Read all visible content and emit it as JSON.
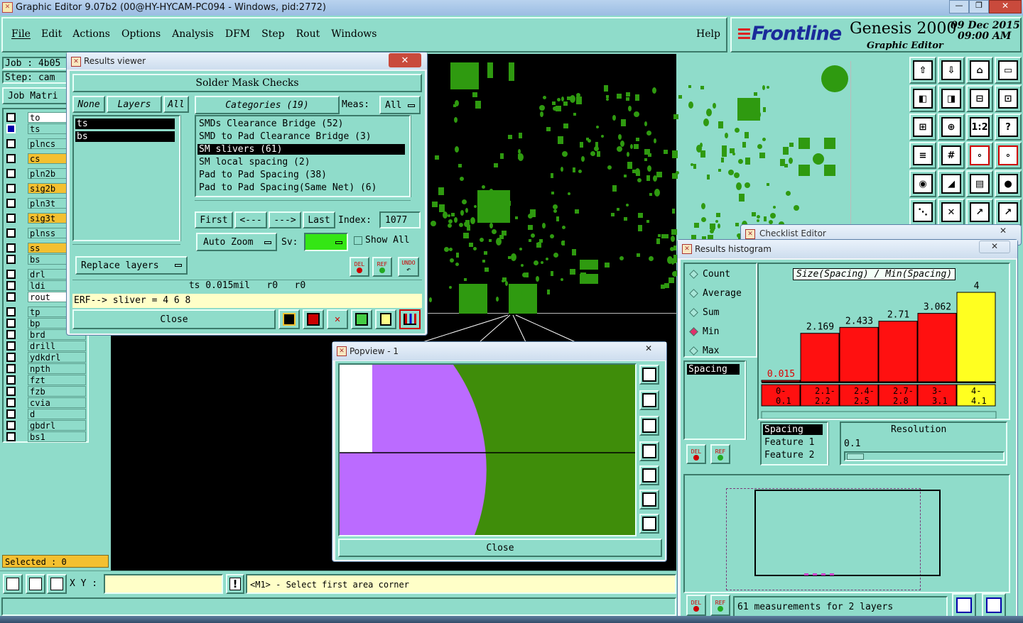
{
  "app": {
    "title": "Graphic Editor 9.07b2 (00@HY-HYCAM-PC094 - Windows, pid:2772)",
    "window_controls": [
      "—",
      "❐",
      "✕"
    ]
  },
  "menu": {
    "items": [
      "File",
      "Edit",
      "Actions",
      "Options",
      "Analysis",
      "DFM",
      "Step",
      "Rout",
      "Windows"
    ],
    "help": "Help"
  },
  "brand": {
    "logo": "Frontline",
    "product": "Genesis 2000",
    "subtitle": "Graphic Editor",
    "date": "09 Dec 2015",
    "time": "09:00 AM"
  },
  "job": {
    "job_label": "Job : 4b05",
    "step_label": "Step: cam",
    "matrix_button": "Job Matri"
  },
  "layers": [
    {
      "name": "to",
      "color": "#ffffff"
    },
    {
      "name": "ts",
      "color": "#8fdcca",
      "active": true
    },
    {
      "name": "plncs",
      "color": "#8fdcca"
    },
    {
      "name": "cs",
      "color": "#f4c030"
    },
    {
      "name": "pln2b",
      "color": "#8fdcca"
    },
    {
      "name": "sig2b",
      "color": "#f4c030"
    },
    {
      "name": "pln3t",
      "color": "#8fdcca"
    },
    {
      "name": "sig3t",
      "color": "#f4c030"
    },
    {
      "name": "plnss",
      "color": "#8fdcca"
    },
    {
      "name": "ss",
      "color": "#f4c030"
    },
    {
      "name": "bs",
      "color": "#8fdcca"
    },
    {
      "name": "drl",
      "color": "#8fdcca"
    },
    {
      "name": "ldi",
      "color": "#8fdcca"
    },
    {
      "name": "rout",
      "color": "#ffffff"
    },
    {
      "name": "tp",
      "color": "#8fdcca"
    },
    {
      "name": "bp",
      "color": "#8fdcca"
    },
    {
      "name": "brd",
      "color": "#8fdcca"
    },
    {
      "name": "drill",
      "color": "#8fdcca"
    },
    {
      "name": "ydkdrl",
      "color": "#8fdcca"
    },
    {
      "name": "npth",
      "color": "#8fdcca"
    },
    {
      "name": "fzt",
      "color": "#8fdcca"
    },
    {
      "name": "fzb",
      "color": "#8fdcca"
    },
    {
      "name": "cvia",
      "color": "#8fdcca"
    },
    {
      "name": "d",
      "color": "#8fdcca"
    },
    {
      "name": "gbdrl",
      "color": "#8fdcca"
    },
    {
      "name": "bs1",
      "color": "#8fdcca"
    }
  ],
  "selected": "Selected : 0",
  "statusbar": {
    "xy_label": "X Y :",
    "xy_value": "",
    "message": "<M1> - Select first area corner"
  },
  "results_viewer": {
    "title": "Results viewer",
    "header": "Solder Mask Checks",
    "none_btn": "None",
    "layers_btn": "Layers",
    "all_btn": "All",
    "layer_items": [
      "ts",
      "bs"
    ],
    "categories_btn": "Categories (19)",
    "meas_label": "Meas:",
    "meas_value": "All",
    "categories": [
      "SMDs Clearance Bridge (52)",
      "SMD to Pad Clearance Bridge (3)",
      "SM slivers (61)",
      "SM local spacing (2)",
      "Pad to Pad Spacing (38)",
      "Pad to Pad Spacing(Same Net) (6)"
    ],
    "selected_category": 2,
    "first": "First",
    "prev": "<---",
    "next": "--->",
    "last": "Last",
    "index_label": "Index:",
    "index_value": "1077",
    "auto_zoom": "Auto Zoom",
    "sv_label": "Sv:",
    "show_all": "Show All",
    "replace_layers": "Replace layers",
    "del": "DEL",
    "ref": "REF",
    "undo": "UNDO",
    "info_line": "ts 0.015mil   r0   r0",
    "erf_line": "ERF--> sliver = 4 6 8",
    "close": "Close"
  },
  "popview": {
    "title": "Popview - 1",
    "close": "Close"
  },
  "checklist": {
    "title": "Checklist Editor"
  },
  "histogram": {
    "title": "Results histogram",
    "radio_options": [
      "Count",
      "Average",
      "Sum",
      "Min",
      "Max"
    ],
    "selected_option": "Min",
    "list_items": [
      "Spacing"
    ],
    "chart_title": "Size(Spacing) / Min(Spacing)",
    "del": "DEL",
    "ref": "REF",
    "feature_list": [
      "Spacing",
      "Feature 1",
      "Feature 2"
    ],
    "resolution_label": "Resolution",
    "resolution_value": "0.1",
    "summary": "61 measurements for 2 layers"
  },
  "chart_data": {
    "type": "bar",
    "title": "Size(Spacing) / Min(Spacing)",
    "categories": [
      "0-0.1",
      "2.1-2.2",
      "2.4-2.5",
      "2.7-2.8",
      "3-3.1",
      "4-4.1"
    ],
    "values": [
      0.015,
      2.169,
      2.433,
      2.71,
      3.062,
      4
    ],
    "labels": [
      "0.015",
      "2.169",
      "2.433",
      "2.71",
      "3.062",
      "4"
    ],
    "bin_labels_line1": [
      "0-",
      "2.1-",
      "2.4-",
      "2.7-",
      "3-",
      "4-"
    ],
    "bin_labels_line2": [
      "0.1",
      "2.2",
      "2.5",
      "2.8",
      "3.1",
      "4.1"
    ],
    "colors": [
      "#ff1010",
      "#ff1010",
      "#ff1010",
      "#ff1010",
      "#ff1010",
      "#ffff20"
    ],
    "ylim": [
      0,
      4
    ]
  },
  "colors": {
    "panel": "#8fdcca",
    "canvas": "#000000",
    "copper": "#2f9a10",
    "violet": "#bb6bff"
  }
}
